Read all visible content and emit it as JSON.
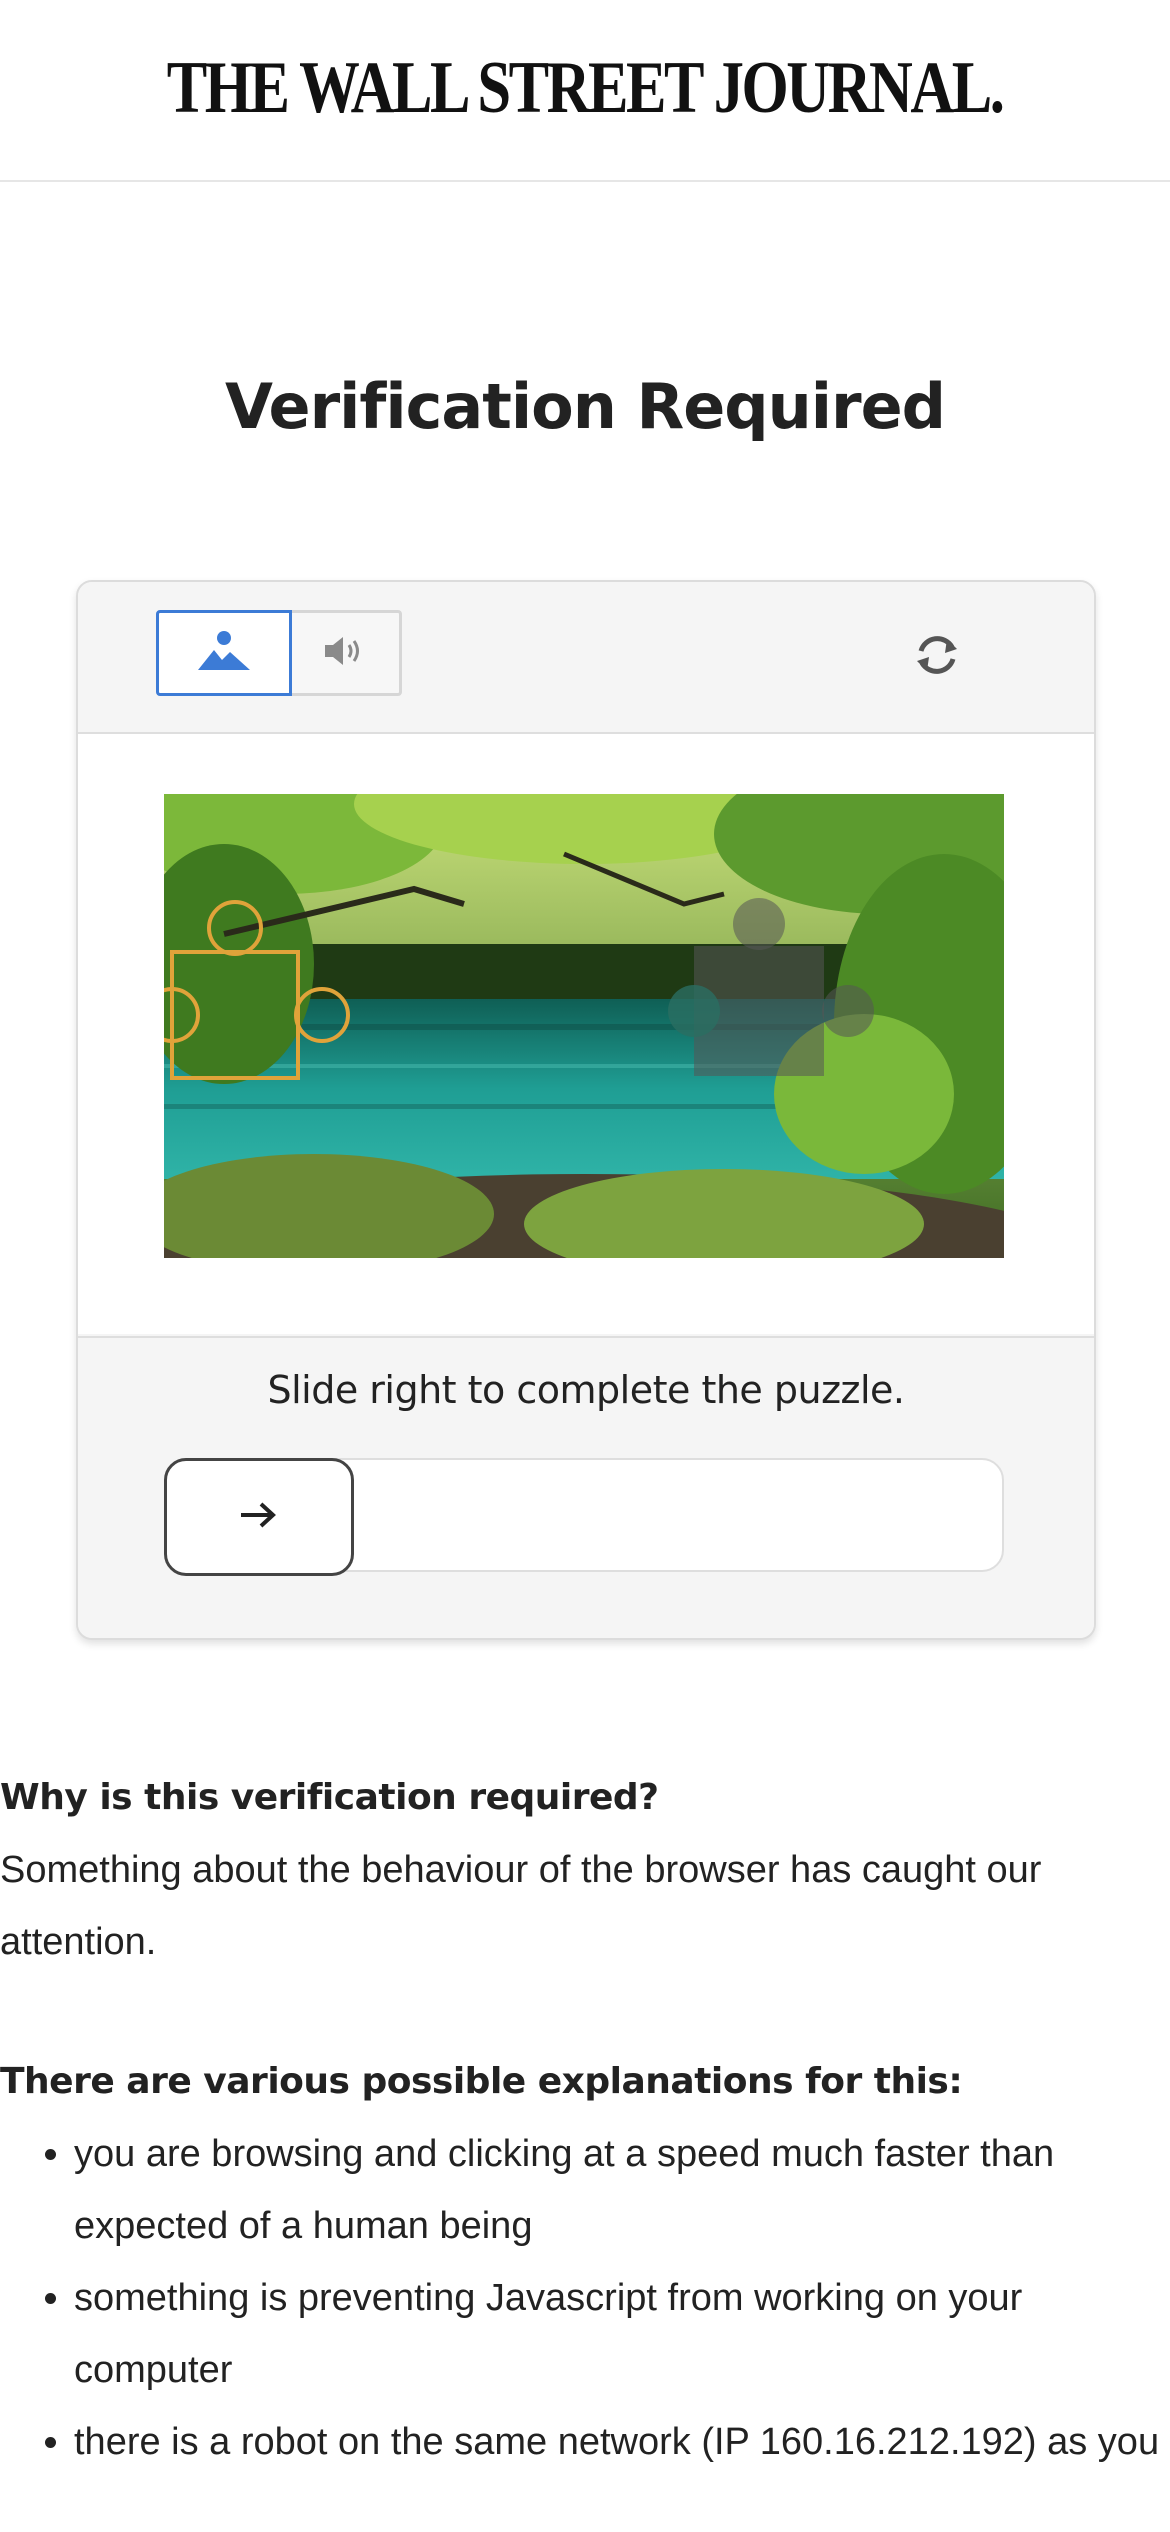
{
  "header": {
    "logo_text": "THE WALL STREET JOURNAL."
  },
  "page": {
    "title": "Verification Required"
  },
  "captcha": {
    "modes": [
      {
        "icon": "image-mode-icon",
        "active": true
      },
      {
        "icon": "audio-mode-icon",
        "active": false
      }
    ],
    "refresh_icon": "refresh-icon",
    "instruction": "Slide right to complete the puzzle.",
    "slider_progress": 0,
    "slider_icon": "arrow-right-icon",
    "colors": {
      "active_border": "#3c7bd6",
      "piece_outline": "#e0a33a",
      "water": "#1f9e94",
      "foliage": "#5c9a2e"
    }
  },
  "info": {
    "why_heading": "Why is this verification required?",
    "why_text": "Something about the behaviour of the browser has caught our attention.",
    "explanations_heading": "There are various possible explanations for this:",
    "explanations": [
      "you are browsing and clicking at a speed much faster than expected of a human being",
      "something is preventing Javascript from working on your computer",
      "there is a robot on the same network (IP 160.16.212.192) as you"
    ]
  }
}
